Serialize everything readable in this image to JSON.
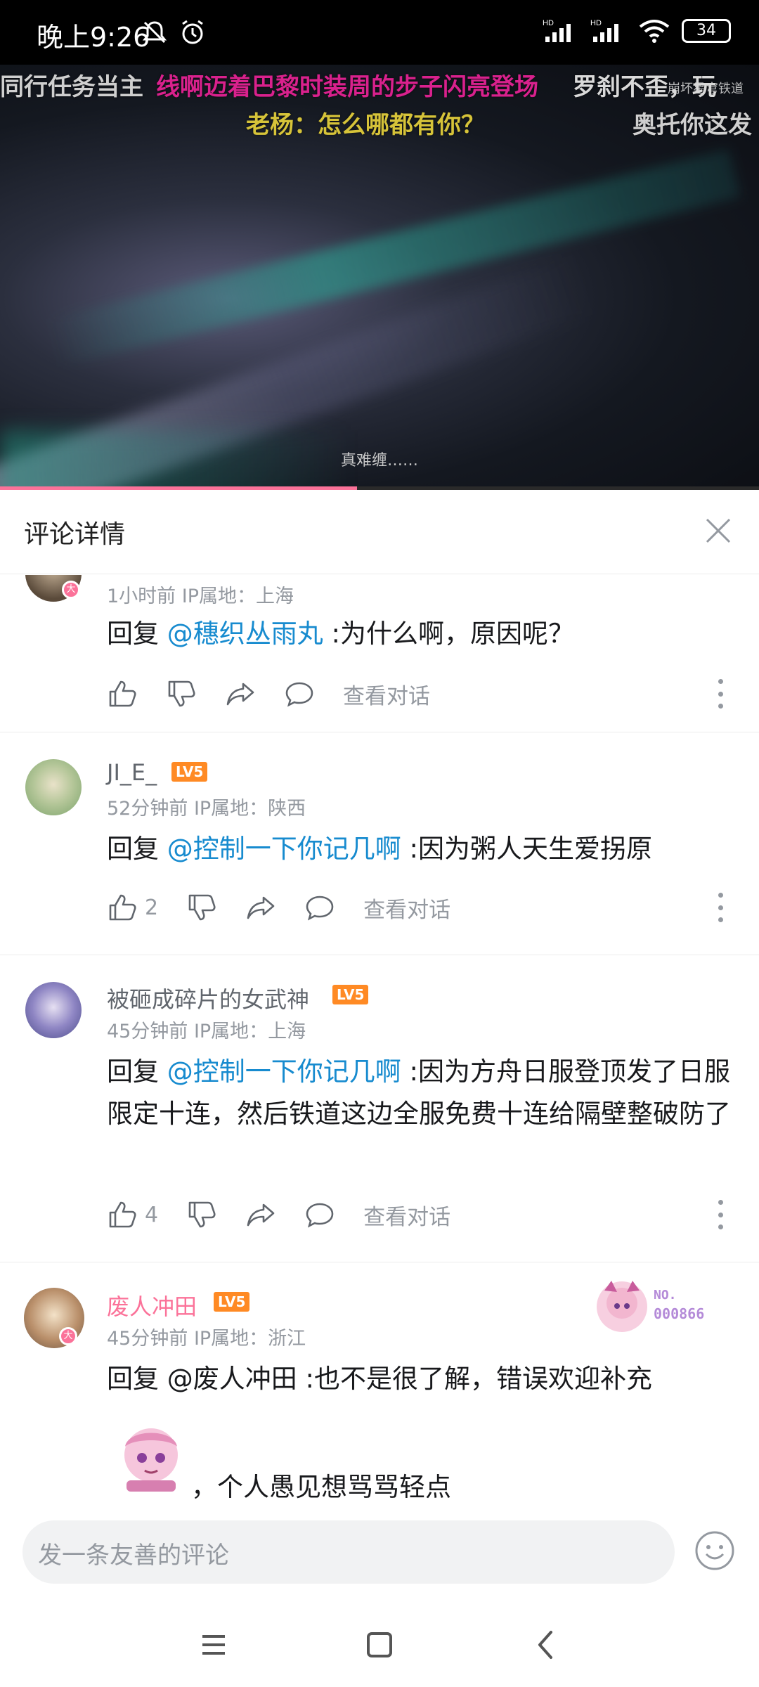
{
  "status_bar": {
    "time": "晚上9:26",
    "battery": "34"
  },
  "video": {
    "danmaku": [
      "同行任务当主",
      "线啊迈着巴黎时装周的步子闪亮登场",
      "老杨：怎么哪都有你？",
      "奥托你这发",
      "罗刹不歪，玩"
    ],
    "watermark": "崩坏星穹铁道",
    "subtitle": "真难缠……",
    "progress": 0.47
  },
  "panel": {
    "title": "评论详情"
  },
  "comments": [
    {
      "username": "",
      "meta": "1小时前  IP属地：上海",
      "reply_prefix": "回复 ",
      "mention": "@穗织丛雨丸",
      "text": " :为什么啊，原因呢？",
      "likes": "",
      "view_convo": "查看对话"
    },
    {
      "username": "JI_E_",
      "level": "LV5",
      "meta": "52分钟前  IP属地：陕西",
      "reply_prefix": "回复 ",
      "mention": "@控制一下你记几啊",
      "text": " :因为粥人天生爱拐原",
      "likes": "2",
      "view_convo": "查看对话"
    },
    {
      "username": "被砸成碎片的女武神",
      "level": "LV5",
      "meta": "45分钟前  IP属地：上海",
      "reply_prefix": "回复 ",
      "mention": "@控制一下你记几啊",
      "text": " :因为方舟日服登顶发了日服限定十连，然后铁道这边全服免费十连给隔壁整破防了",
      "likes": "4",
      "view_convo": "查看对话"
    },
    {
      "username": "废人冲田",
      "level": "LV5",
      "meta": "45分钟前  IP属地：浙江",
      "reply_prefix": "回复 @废人冲田",
      "text": " :也不是很了解，错误欢迎补充",
      "text2": "，个人愚见想骂骂轻点",
      "fan_badge_no": "NO.",
      "fan_badge_num": "000866"
    }
  ],
  "input": {
    "placeholder": "发一条友善的评论"
  },
  "colors": {
    "accent_pink": "#fb7299",
    "link_blue": "#178bcf",
    "level_orange": "#ff8a24"
  }
}
